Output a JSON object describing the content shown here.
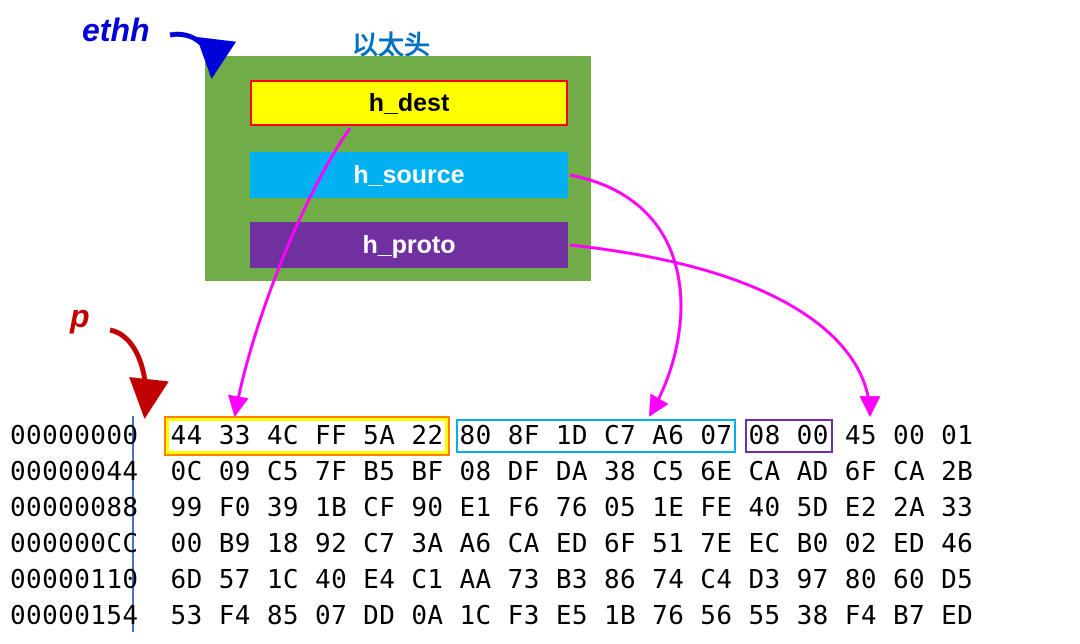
{
  "labels": {
    "ethh": "ethh",
    "p": "p",
    "ethernet_header": "以太头"
  },
  "struct": {
    "fields": {
      "h_dest": "h_dest",
      "h_source": "h_source",
      "h_proto": "h_proto"
    }
  },
  "hex": {
    "offsets": [
      "00000000",
      "00000044",
      "00000088",
      "000000CC",
      "00000110",
      "00000154"
    ],
    "row0": {
      "dest": "44 33 4C FF 5A 22",
      "source": "80 8F 1D C7 A6 07",
      "proto": "08 00",
      "rest": "45 00 01"
    },
    "rows_rest": [
      "0C 09 C5 7F B5 BF 08 DF DA 38 C5 6E CA AD 6F CA 2B",
      "99 F0 39 1B CF 90 E1 F6 76 05 1E FE 40 5D E2 2A 33",
      "00 B9 18 92 C7 3A A6 CA ED 6F 51 7E EC B0 02 ED 46",
      "6D 57 1C 40 E4 C1 AA 73 B3 86 74 C4 D3 97 80 60 D5",
      "53 F4 85 07 DD 0A 1C F3 E5 1B 76 56 55 38 F4 B7 ED"
    ]
  },
  "colors": {
    "struct_bg": "#70ad47",
    "h_dest_bg": "#ffff00",
    "h_source_bg": "#00b0f0",
    "h_proto_bg": "#7030a0",
    "ethh_color": "#0000d8",
    "p_color": "#c00000",
    "arrow_link": "#ff00ff"
  }
}
